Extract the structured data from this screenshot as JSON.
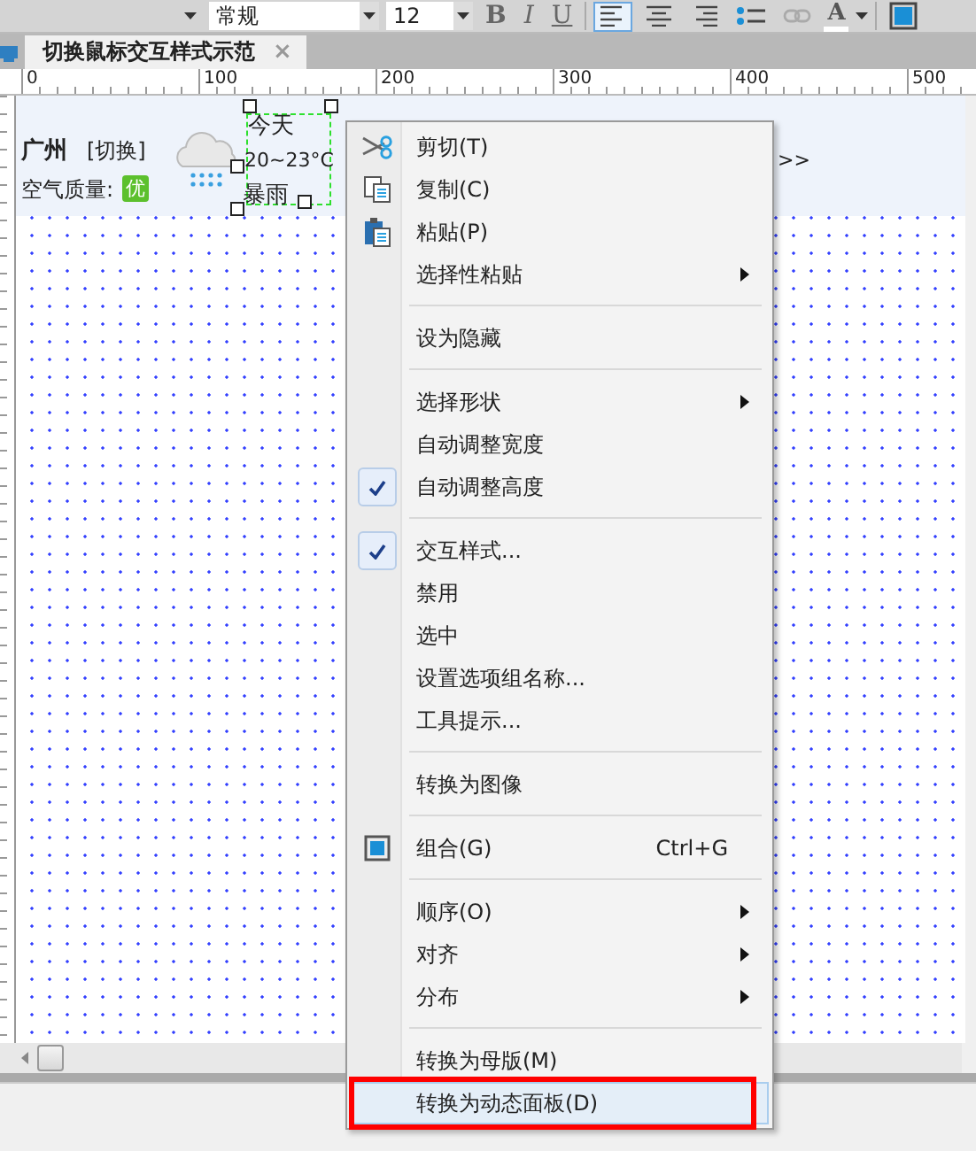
{
  "toolbar": {
    "font_style": "常规",
    "font_size": "12",
    "format_buttons": [
      {
        "label": "B",
        "kind": "bold"
      },
      {
        "label": "I",
        "kind": "italic"
      },
      {
        "label": "U",
        "kind": "underline"
      }
    ],
    "align_buttons": [
      {
        "selected": true
      },
      {
        "selected": false
      },
      {
        "selected": false
      }
    ],
    "font_color": "A"
  },
  "tabs": [
    {
      "label": "切换鼠标交互样式示范",
      "close": "×"
    }
  ],
  "ruler": {
    "labels": [
      "0",
      "100",
      "200",
      "300",
      "400",
      "500"
    ]
  },
  "widget": {
    "city": "广州",
    "switch": "[切换]",
    "air_label": "空气质量:",
    "air_value": "优",
    "today": "今天",
    "temperature": "20~23°C",
    "weather": "暴雨",
    "more": ">>"
  },
  "context_menu": {
    "items": [
      {
        "kind": "item",
        "label": "剪切(T)",
        "checked": false,
        "submenu": false,
        "selected": false
      },
      {
        "kind": "item",
        "label": "复制(C)",
        "checked": false,
        "submenu": false,
        "selected": false
      },
      {
        "kind": "item",
        "label": "粘贴(P)",
        "checked": false,
        "submenu": false,
        "selected": false
      },
      {
        "kind": "item",
        "label": "选择性粘贴",
        "checked": false,
        "submenu": true,
        "selected": false
      },
      {
        "kind": "separator"
      },
      {
        "kind": "item",
        "label": "设为隐藏",
        "checked": false,
        "submenu": false,
        "selected": false
      },
      {
        "kind": "separator"
      },
      {
        "kind": "item",
        "label": "选择形状",
        "checked": false,
        "submenu": true,
        "selected": false
      },
      {
        "kind": "item",
        "label": "自动调整宽度",
        "checked": false,
        "submenu": false,
        "selected": false
      },
      {
        "kind": "item",
        "label": "自动调整高度",
        "checked": true,
        "submenu": false,
        "selected": false
      },
      {
        "kind": "separator"
      },
      {
        "kind": "item",
        "label": "交互样式...",
        "checked": true,
        "submenu": false,
        "selected": false
      },
      {
        "kind": "item",
        "label": "禁用",
        "checked": false,
        "submenu": false,
        "selected": false
      },
      {
        "kind": "item",
        "label": "选中",
        "checked": false,
        "submenu": false,
        "selected": false
      },
      {
        "kind": "item",
        "label": "设置选项组名称...",
        "checked": false,
        "submenu": false,
        "selected": false
      },
      {
        "kind": "item",
        "label": "工具提示...",
        "checked": false,
        "submenu": false,
        "selected": false
      },
      {
        "kind": "separator"
      },
      {
        "kind": "item",
        "label": "转换为图像",
        "checked": false,
        "submenu": false,
        "selected": false
      },
      {
        "kind": "separator"
      },
      {
        "kind": "item",
        "label": "组合(G)",
        "shortcut": "Ctrl+G",
        "checked": false,
        "submenu": false,
        "selected": false
      },
      {
        "kind": "separator"
      },
      {
        "kind": "item",
        "label": "顺序(O)",
        "checked": false,
        "submenu": true,
        "selected": false
      },
      {
        "kind": "item",
        "label": "对齐",
        "checked": false,
        "submenu": true,
        "selected": false
      },
      {
        "kind": "item",
        "label": "分布",
        "checked": false,
        "submenu": true,
        "selected": false
      },
      {
        "kind": "separator"
      },
      {
        "kind": "item",
        "label": "转换为母版(M)",
        "checked": false,
        "submenu": false,
        "selected": false
      },
      {
        "kind": "item",
        "label": "转换为动态面板(D)",
        "checked": false,
        "submenu": false,
        "selected": true
      }
    ]
  }
}
